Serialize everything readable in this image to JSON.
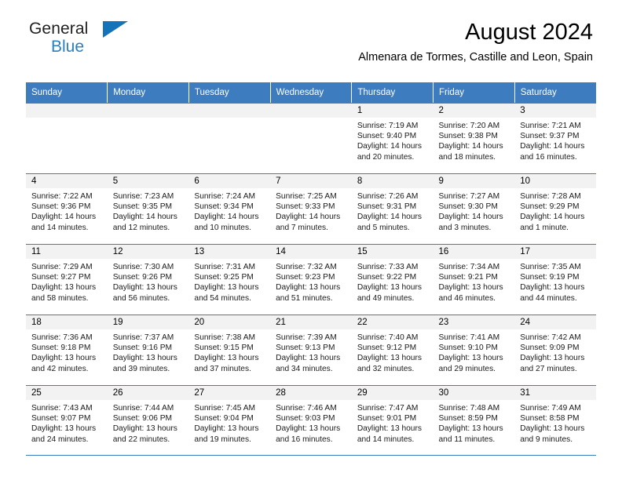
{
  "brand": {
    "word1": "General",
    "word2": "Blue",
    "flag_color": "#1574b9",
    "text_color": "#231f20",
    "accent_color": "#2a7fc1"
  },
  "header": {
    "title": "August 2024",
    "subtitle": "Almenara de Tormes, Castille and Leon, Spain"
  },
  "theme": {
    "header_bg": "#3d7cbf",
    "header_text": "#ffffff",
    "daynum_bg": "#f2f2f2",
    "cell_bg": "#ffffff",
    "grid_line": "#3d7cbf"
  },
  "weekday_headers": [
    "Sunday",
    "Monday",
    "Tuesday",
    "Wednesday",
    "Thursday",
    "Friday",
    "Saturday"
  ],
  "weeks": [
    [
      {
        "day": "",
        "sunrise": "",
        "sunset": "",
        "daylight1": "",
        "daylight2": ""
      },
      {
        "day": "",
        "sunrise": "",
        "sunset": "",
        "daylight1": "",
        "daylight2": ""
      },
      {
        "day": "",
        "sunrise": "",
        "sunset": "",
        "daylight1": "",
        "daylight2": ""
      },
      {
        "day": "",
        "sunrise": "",
        "sunset": "",
        "daylight1": "",
        "daylight2": ""
      },
      {
        "day": "1",
        "sunrise": "Sunrise: 7:19 AM",
        "sunset": "Sunset: 9:40 PM",
        "daylight1": "Daylight: 14 hours",
        "daylight2": "and 20 minutes."
      },
      {
        "day": "2",
        "sunrise": "Sunrise: 7:20 AM",
        "sunset": "Sunset: 9:38 PM",
        "daylight1": "Daylight: 14 hours",
        "daylight2": "and 18 minutes."
      },
      {
        "day": "3",
        "sunrise": "Sunrise: 7:21 AM",
        "sunset": "Sunset: 9:37 PM",
        "daylight1": "Daylight: 14 hours",
        "daylight2": "and 16 minutes."
      }
    ],
    [
      {
        "day": "4",
        "sunrise": "Sunrise: 7:22 AM",
        "sunset": "Sunset: 9:36 PM",
        "daylight1": "Daylight: 14 hours",
        "daylight2": "and 14 minutes."
      },
      {
        "day": "5",
        "sunrise": "Sunrise: 7:23 AM",
        "sunset": "Sunset: 9:35 PM",
        "daylight1": "Daylight: 14 hours",
        "daylight2": "and 12 minutes."
      },
      {
        "day": "6",
        "sunrise": "Sunrise: 7:24 AM",
        "sunset": "Sunset: 9:34 PM",
        "daylight1": "Daylight: 14 hours",
        "daylight2": "and 10 minutes."
      },
      {
        "day": "7",
        "sunrise": "Sunrise: 7:25 AM",
        "sunset": "Sunset: 9:33 PM",
        "daylight1": "Daylight: 14 hours",
        "daylight2": "and 7 minutes."
      },
      {
        "day": "8",
        "sunrise": "Sunrise: 7:26 AM",
        "sunset": "Sunset: 9:31 PM",
        "daylight1": "Daylight: 14 hours",
        "daylight2": "and 5 minutes."
      },
      {
        "day": "9",
        "sunrise": "Sunrise: 7:27 AM",
        "sunset": "Sunset: 9:30 PM",
        "daylight1": "Daylight: 14 hours",
        "daylight2": "and 3 minutes."
      },
      {
        "day": "10",
        "sunrise": "Sunrise: 7:28 AM",
        "sunset": "Sunset: 9:29 PM",
        "daylight1": "Daylight: 14 hours",
        "daylight2": "and 1 minute."
      }
    ],
    [
      {
        "day": "11",
        "sunrise": "Sunrise: 7:29 AM",
        "sunset": "Sunset: 9:27 PM",
        "daylight1": "Daylight: 13 hours",
        "daylight2": "and 58 minutes."
      },
      {
        "day": "12",
        "sunrise": "Sunrise: 7:30 AM",
        "sunset": "Sunset: 9:26 PM",
        "daylight1": "Daylight: 13 hours",
        "daylight2": "and 56 minutes."
      },
      {
        "day": "13",
        "sunrise": "Sunrise: 7:31 AM",
        "sunset": "Sunset: 9:25 PM",
        "daylight1": "Daylight: 13 hours",
        "daylight2": "and 54 minutes."
      },
      {
        "day": "14",
        "sunrise": "Sunrise: 7:32 AM",
        "sunset": "Sunset: 9:23 PM",
        "daylight1": "Daylight: 13 hours",
        "daylight2": "and 51 minutes."
      },
      {
        "day": "15",
        "sunrise": "Sunrise: 7:33 AM",
        "sunset": "Sunset: 9:22 PM",
        "daylight1": "Daylight: 13 hours",
        "daylight2": "and 49 minutes."
      },
      {
        "day": "16",
        "sunrise": "Sunrise: 7:34 AM",
        "sunset": "Sunset: 9:21 PM",
        "daylight1": "Daylight: 13 hours",
        "daylight2": "and 46 minutes."
      },
      {
        "day": "17",
        "sunrise": "Sunrise: 7:35 AM",
        "sunset": "Sunset: 9:19 PM",
        "daylight1": "Daylight: 13 hours",
        "daylight2": "and 44 minutes."
      }
    ],
    [
      {
        "day": "18",
        "sunrise": "Sunrise: 7:36 AM",
        "sunset": "Sunset: 9:18 PM",
        "daylight1": "Daylight: 13 hours",
        "daylight2": "and 42 minutes."
      },
      {
        "day": "19",
        "sunrise": "Sunrise: 7:37 AM",
        "sunset": "Sunset: 9:16 PM",
        "daylight1": "Daylight: 13 hours",
        "daylight2": "and 39 minutes."
      },
      {
        "day": "20",
        "sunrise": "Sunrise: 7:38 AM",
        "sunset": "Sunset: 9:15 PM",
        "daylight1": "Daylight: 13 hours",
        "daylight2": "and 37 minutes."
      },
      {
        "day": "21",
        "sunrise": "Sunrise: 7:39 AM",
        "sunset": "Sunset: 9:13 PM",
        "daylight1": "Daylight: 13 hours",
        "daylight2": "and 34 minutes."
      },
      {
        "day": "22",
        "sunrise": "Sunrise: 7:40 AM",
        "sunset": "Sunset: 9:12 PM",
        "daylight1": "Daylight: 13 hours",
        "daylight2": "and 32 minutes."
      },
      {
        "day": "23",
        "sunrise": "Sunrise: 7:41 AM",
        "sunset": "Sunset: 9:10 PM",
        "daylight1": "Daylight: 13 hours",
        "daylight2": "and 29 minutes."
      },
      {
        "day": "24",
        "sunrise": "Sunrise: 7:42 AM",
        "sunset": "Sunset: 9:09 PM",
        "daylight1": "Daylight: 13 hours",
        "daylight2": "and 27 minutes."
      }
    ],
    [
      {
        "day": "25",
        "sunrise": "Sunrise: 7:43 AM",
        "sunset": "Sunset: 9:07 PM",
        "daylight1": "Daylight: 13 hours",
        "daylight2": "and 24 minutes."
      },
      {
        "day": "26",
        "sunrise": "Sunrise: 7:44 AM",
        "sunset": "Sunset: 9:06 PM",
        "daylight1": "Daylight: 13 hours",
        "daylight2": "and 22 minutes."
      },
      {
        "day": "27",
        "sunrise": "Sunrise: 7:45 AM",
        "sunset": "Sunset: 9:04 PM",
        "daylight1": "Daylight: 13 hours",
        "daylight2": "and 19 minutes."
      },
      {
        "day": "28",
        "sunrise": "Sunrise: 7:46 AM",
        "sunset": "Sunset: 9:03 PM",
        "daylight1": "Daylight: 13 hours",
        "daylight2": "and 16 minutes."
      },
      {
        "day": "29",
        "sunrise": "Sunrise: 7:47 AM",
        "sunset": "Sunset: 9:01 PM",
        "daylight1": "Daylight: 13 hours",
        "daylight2": "and 14 minutes."
      },
      {
        "day": "30",
        "sunrise": "Sunrise: 7:48 AM",
        "sunset": "Sunset: 8:59 PM",
        "daylight1": "Daylight: 13 hours",
        "daylight2": "and 11 minutes."
      },
      {
        "day": "31",
        "sunrise": "Sunrise: 7:49 AM",
        "sunset": "Sunset: 8:58 PM",
        "daylight1": "Daylight: 13 hours",
        "daylight2": "and 9 minutes."
      }
    ]
  ]
}
